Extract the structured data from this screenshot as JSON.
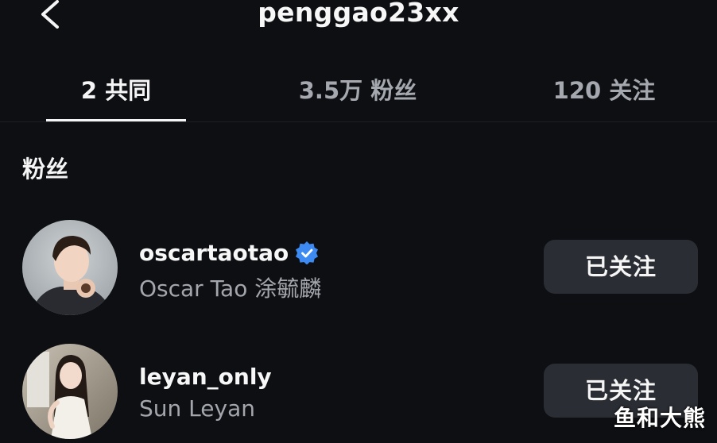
{
  "header": {
    "title": "penggao23xx",
    "back_icon": "chevron-left-icon"
  },
  "tabs": [
    {
      "label": "2 共同",
      "active": true
    },
    {
      "label": "3.5万 粉丝",
      "active": false
    },
    {
      "label": "120 关注",
      "active": false
    }
  ],
  "section": {
    "title": "粉丝"
  },
  "users": [
    {
      "username": "oscartaotao",
      "display_name": "Oscar Tao 涂毓麟",
      "verified": true,
      "button_label": "已关注"
    },
    {
      "username": "leyan_only",
      "display_name": "Sun Leyan",
      "verified": false,
      "button_label": "已关注"
    }
  ],
  "watermark": "鱼和大熊",
  "colors": {
    "background": "#0d0f13",
    "button_bg": "#2a2d33",
    "verified_blue": "#3d8bf2",
    "muted_text": "#a3a6ac"
  }
}
